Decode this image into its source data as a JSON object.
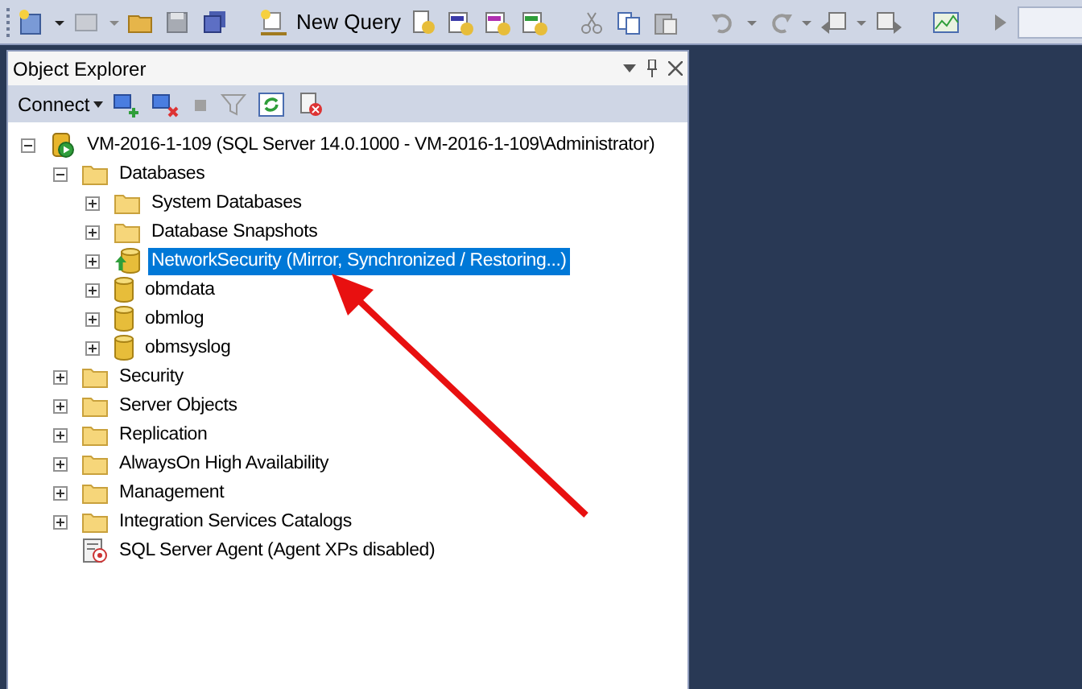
{
  "toolbar": {
    "new_query": "New Query"
  },
  "panel": {
    "title": "Object Explorer",
    "connect": "Connect"
  },
  "tree": [
    {
      "kind": "server",
      "label": "VM-2016-1-109 (SQL Server 14.0.1000 - VM-2016-1-109\\Administrator)",
      "expanded": true,
      "selected": false,
      "children": [
        {
          "kind": "folder",
          "label": "Databases",
          "expanded": true,
          "selected": false,
          "children": [
            {
              "kind": "folder",
              "label": "System Databases",
              "expanded": false,
              "selected": false
            },
            {
              "kind": "folder",
              "label": "Database Snapshots",
              "expanded": false,
              "selected": false
            },
            {
              "kind": "mirror",
              "label": "NetworkSecurity (Mirror, Synchronized / Restoring...)",
              "expanded": false,
              "selected": true
            },
            {
              "kind": "database",
              "label": "obmdata",
              "expanded": false,
              "selected": false
            },
            {
              "kind": "database",
              "label": "obmlog",
              "expanded": false,
              "selected": false
            },
            {
              "kind": "database",
              "label": "obmsyslog",
              "expanded": false,
              "selected": false
            }
          ]
        },
        {
          "kind": "folder",
          "label": "Security",
          "expanded": false,
          "selected": false
        },
        {
          "kind": "folder",
          "label": "Server Objects",
          "expanded": false,
          "selected": false
        },
        {
          "kind": "folder",
          "label": "Replication",
          "expanded": false,
          "selected": false
        },
        {
          "kind": "folder",
          "label": "AlwaysOn High Availability",
          "expanded": false,
          "selected": false
        },
        {
          "kind": "folder",
          "label": "Management",
          "expanded": false,
          "selected": false
        },
        {
          "kind": "folder",
          "label": "Integration Services Catalogs",
          "expanded": false,
          "selected": false
        },
        {
          "kind": "agent",
          "label": "SQL Server Agent (Agent XPs disabled)",
          "selected": false
        }
      ]
    }
  ]
}
